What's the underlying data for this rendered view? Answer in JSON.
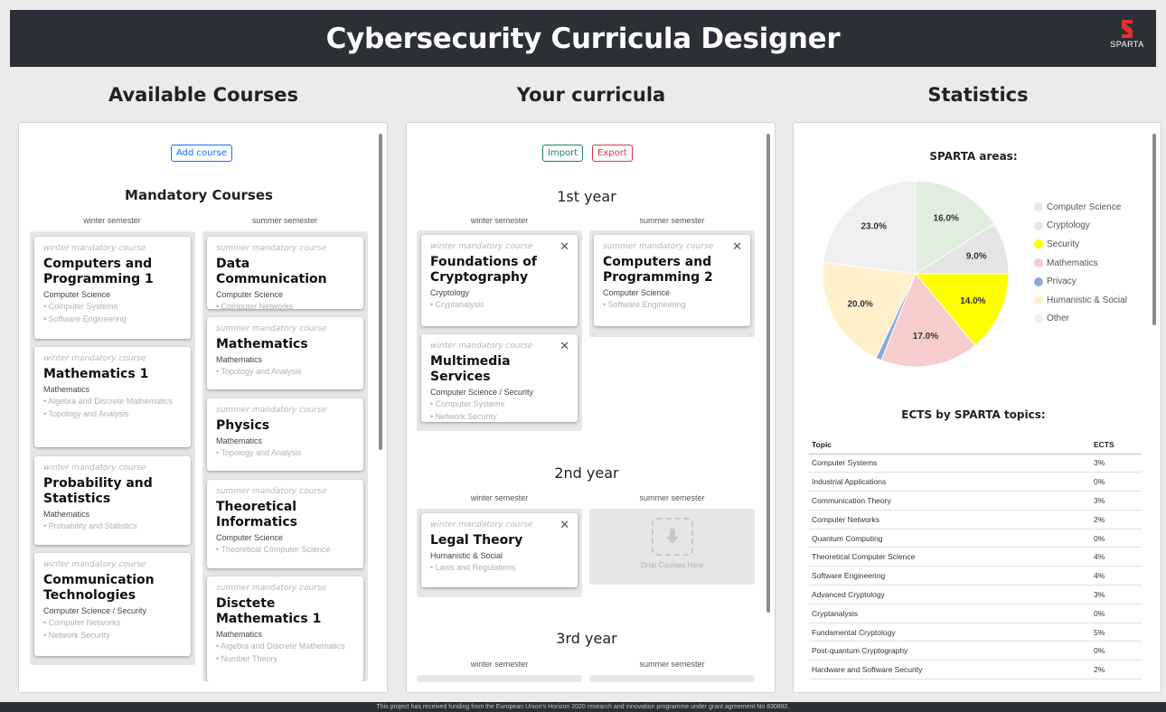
{
  "app": {
    "title": "Cybersecurity Curricula Designer",
    "logo_text": "SPARTA"
  },
  "columns": {
    "available": "Available Courses",
    "curricula": "Your curricula",
    "statistics": "Statistics"
  },
  "available": {
    "add_button": "Add course",
    "section_title": "Mandatory Courses",
    "winter_label": "winter semester",
    "summer_label": "summer semester",
    "winter_courses": [
      {
        "type": "winter mandatory course",
        "title": "Computers and Programming 1",
        "area": "Computer Science",
        "topics": [
          "• Computer Systems",
          "• Software Engineering"
        ]
      },
      {
        "type": "winter mandatory course",
        "title": "Mathematics 1",
        "area": "Mathematics",
        "topics": [
          "• Algebra and Discrete Mathematics",
          "• Topology and Analysis"
        ]
      },
      {
        "type": "winter mandatory course",
        "title": "Probability and Statistics",
        "area": "Mathematics",
        "topics": [
          "• Probability and Statistics"
        ]
      },
      {
        "type": "winter mandatory course",
        "title": "Communication Technologies",
        "area": "Computer Science / Security",
        "topics": [
          "• Computer Networks",
          "• Network Security"
        ]
      }
    ],
    "summer_courses": [
      {
        "type": "summer mandatory course",
        "title": "Data Communication",
        "area": "Computer Science",
        "topics": [
          "• Computer Networks"
        ]
      },
      {
        "type": "summer mandatory course",
        "title": "Mathematics",
        "area": "Mathematics",
        "topics": [
          "• Topology and Analysis"
        ]
      },
      {
        "type": "summer mandatory course",
        "title": "Physics",
        "area": "Mathematics",
        "topics": [
          "• Topology and Analysis"
        ]
      },
      {
        "type": "summer mandatory course",
        "title": "Theoretical Informatics",
        "area": "Computer Science",
        "topics": [
          "• Theoretical Computer Science"
        ]
      },
      {
        "type": "summer mandatory course",
        "title": "Disctete Mathematics 1",
        "area": "Mathematics",
        "topics": [
          "• Algebra and Discrete Mathematics",
          "• Number Theory"
        ]
      }
    ]
  },
  "curricula": {
    "import_button": "Import",
    "export_button": "Export",
    "winter_label": "winter semester",
    "summer_label": "summer semester",
    "years": [
      {
        "title": "1st year",
        "winter": [
          {
            "type": "winter mandatory course",
            "title": "Foundations of Cryptography",
            "area": "Cryptology",
            "topics": [
              "• Cryptanalysis"
            ]
          },
          {
            "type": "winter mandatory course",
            "title": "Multimedia Services",
            "area": "Computer Science / Security",
            "topics": [
              "• Computer Systems",
              "• Network Security"
            ]
          }
        ],
        "summer": [
          {
            "type": "summer mandatory course",
            "title": "Computers and Programming 2",
            "area": "Computer Science",
            "topics": [
              "• Software Engineering"
            ]
          }
        ]
      },
      {
        "title": "2nd year",
        "winter": [
          {
            "type": "winter mandatory course",
            "title": "Legal Theory",
            "area": "Humanistic & Social",
            "topics": [
              "• Laws and Regulations"
            ]
          }
        ],
        "summer_drop_text": "Drop Courses Here"
      },
      {
        "title": "3rd year"
      }
    ]
  },
  "statistics": {
    "areas_title": "SPARTA areas:",
    "ects_title": "ECTS by SPARTA topics:",
    "table_headers": {
      "topic": "Topic",
      "ects": "ECTS"
    },
    "table_rows": [
      {
        "topic": "Computer Systems",
        "ects": "3%"
      },
      {
        "topic": "Industrial Applications",
        "ects": "0%"
      },
      {
        "topic": "Communication Theory",
        "ects": "3%"
      },
      {
        "topic": "Computer Networks",
        "ects": "2%"
      },
      {
        "topic": "Quantum Computing",
        "ects": "0%"
      },
      {
        "topic": "Theoretical Computer Science",
        "ects": "4%"
      },
      {
        "topic": "Software Engineering",
        "ects": "4%"
      },
      {
        "topic": "Advanced Cryptology",
        "ects": "3%"
      },
      {
        "topic": "Cryptanalysis",
        "ects": "0%"
      },
      {
        "topic": "Fundamental Cryptology",
        "ects": "5%"
      },
      {
        "topic": "Post-quantum Cryptography",
        "ects": "0%"
      },
      {
        "topic": "Hardware and Software Security",
        "ects": "2%"
      }
    ]
  },
  "chart_data": {
    "type": "pie",
    "title": "SPARTA areas:",
    "categories": [
      "Computer Science",
      "Cryptology",
      "Security",
      "Mathematics",
      "Privacy",
      "Humanistic & Social",
      "Other"
    ],
    "values": [
      16.0,
      9.0,
      14.0,
      17.0,
      1.0,
      20.0,
      23.0
    ],
    "labels": [
      "16.0%",
      "9.0%",
      "14.0%",
      "17.0%",
      "",
      "20.0%",
      "23.0%"
    ],
    "colors": [
      "#dfeedd",
      "#e5e5e5",
      "#ffff00",
      "#f6cccc",
      "#8ea9db",
      "#fff0cc",
      "#efefef"
    ],
    "legend": "right"
  },
  "footer": {
    "text": "This project has received funding from the European Union's Horizon 2020 research and innovation programme under grant agreement No 830892."
  }
}
